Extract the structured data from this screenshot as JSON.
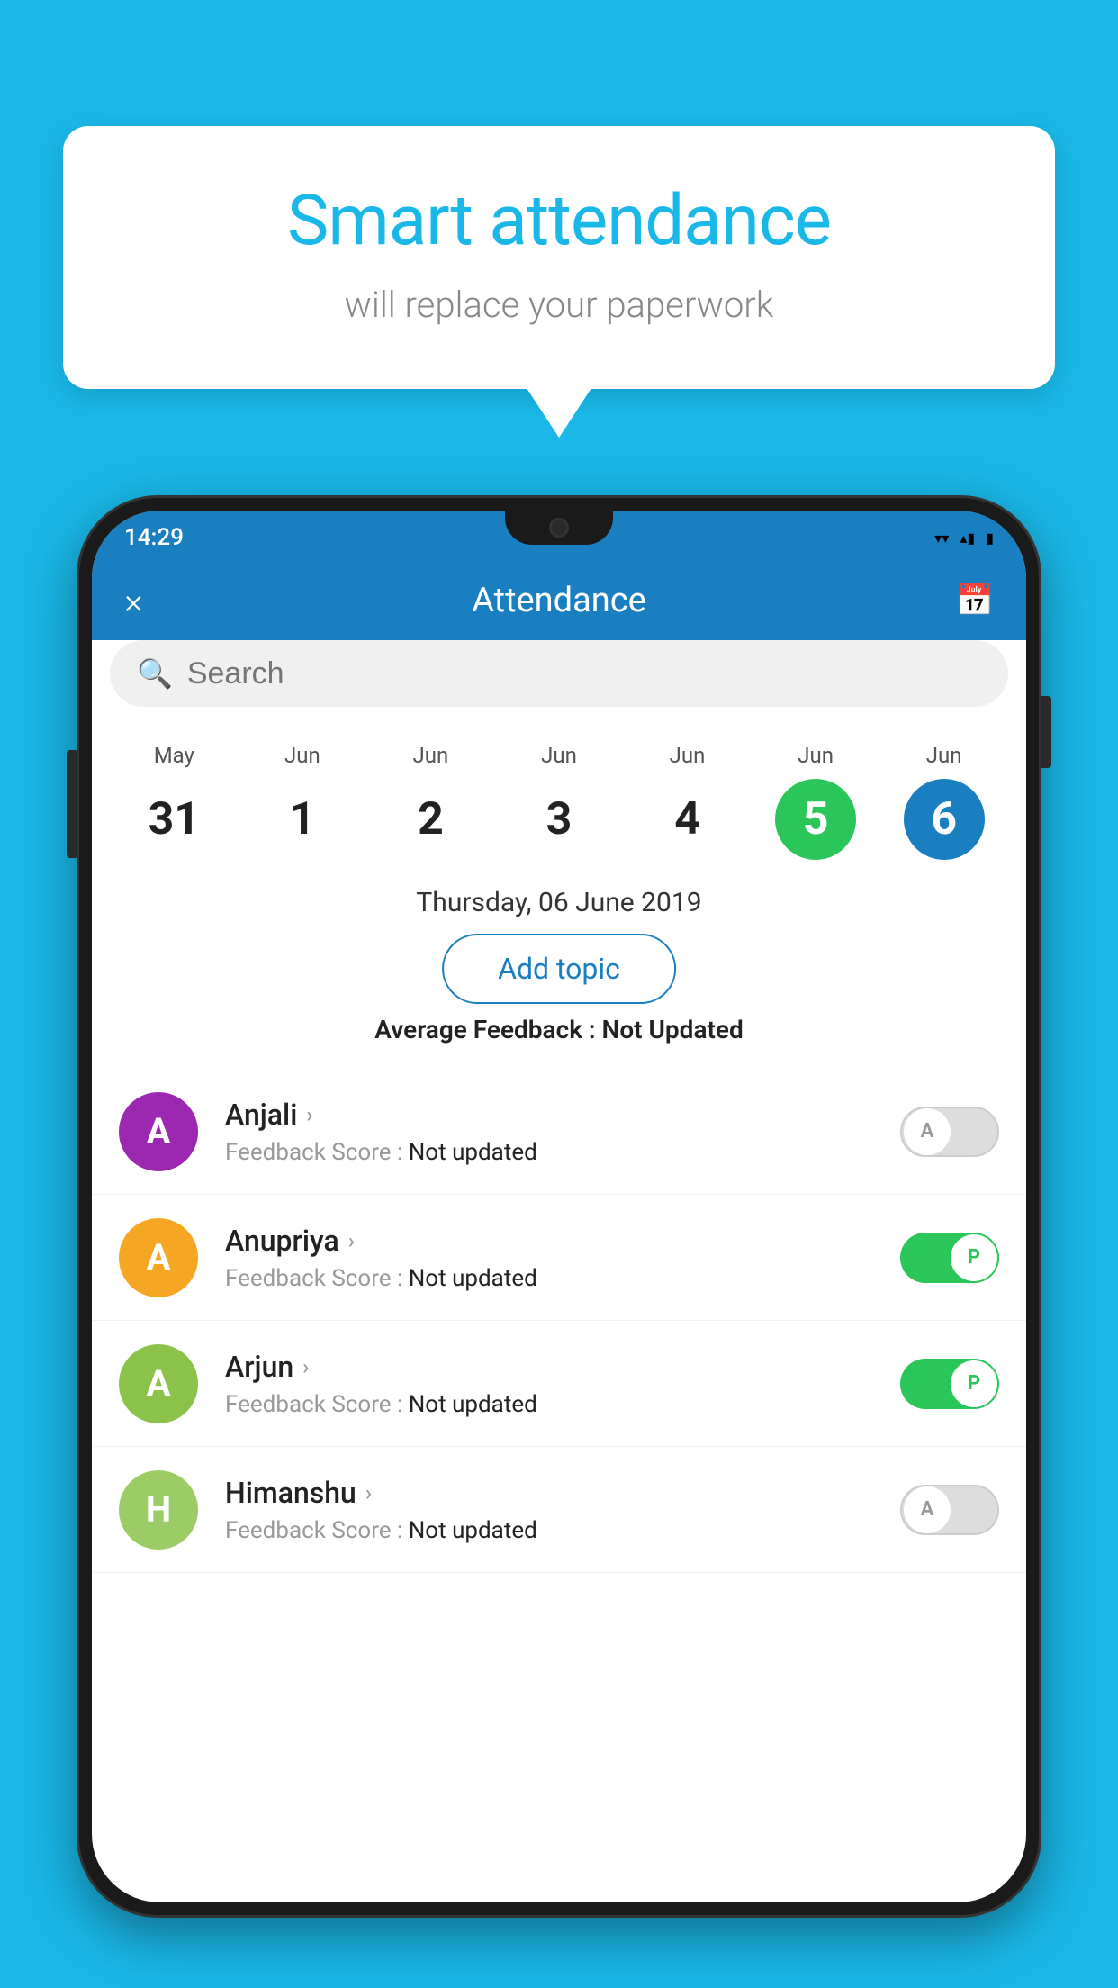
{
  "background_color": "#1ab8e8",
  "speech_bubble": {
    "title": "Smart attendance",
    "subtitle": "will replace your paperwork"
  },
  "status_bar": {
    "time": "14:29",
    "wifi_icon": "▾",
    "signal_icon": "▴",
    "battery_icon": "▮"
  },
  "app_bar": {
    "close_icon": "×",
    "title": "Attendance",
    "calendar_icon": "📅"
  },
  "search": {
    "placeholder": "Search"
  },
  "calendar": {
    "days": [
      {
        "month": "May",
        "num": "31",
        "state": "normal"
      },
      {
        "month": "Jun",
        "num": "1",
        "state": "normal"
      },
      {
        "month": "Jun",
        "num": "2",
        "state": "normal"
      },
      {
        "month": "Jun",
        "num": "3",
        "state": "normal"
      },
      {
        "month": "Jun",
        "num": "4",
        "state": "normal"
      },
      {
        "month": "Jun",
        "num": "5",
        "state": "today"
      },
      {
        "month": "Jun",
        "num": "6",
        "state": "selected"
      }
    ]
  },
  "selected_date": "Thursday, 06 June 2019",
  "add_topic_label": "Add topic",
  "avg_feedback_label": "Average Feedback :",
  "avg_feedback_value": "Not Updated",
  "students": [
    {
      "name": "Anjali",
      "initial": "A",
      "avatar_color": "#9c27b0",
      "feedback_label": "Feedback Score :",
      "feedback_value": "Not updated",
      "toggle": "off",
      "toggle_letter": "A"
    },
    {
      "name": "Anupriya",
      "initial": "A",
      "avatar_color": "#f5a623",
      "feedback_label": "Feedback Score :",
      "feedback_value": "Not updated",
      "toggle": "on",
      "toggle_letter": "P"
    },
    {
      "name": "Arjun",
      "initial": "A",
      "avatar_color": "#8bc34a",
      "feedback_label": "Feedback Score :",
      "feedback_value": "Not updated",
      "toggle": "on",
      "toggle_letter": "P"
    },
    {
      "name": "Himanshu",
      "initial": "H",
      "avatar_color": "#9ccc65",
      "feedback_label": "Feedback Score :",
      "feedback_value": "Not updated",
      "toggle": "off",
      "toggle_letter": "A"
    }
  ]
}
